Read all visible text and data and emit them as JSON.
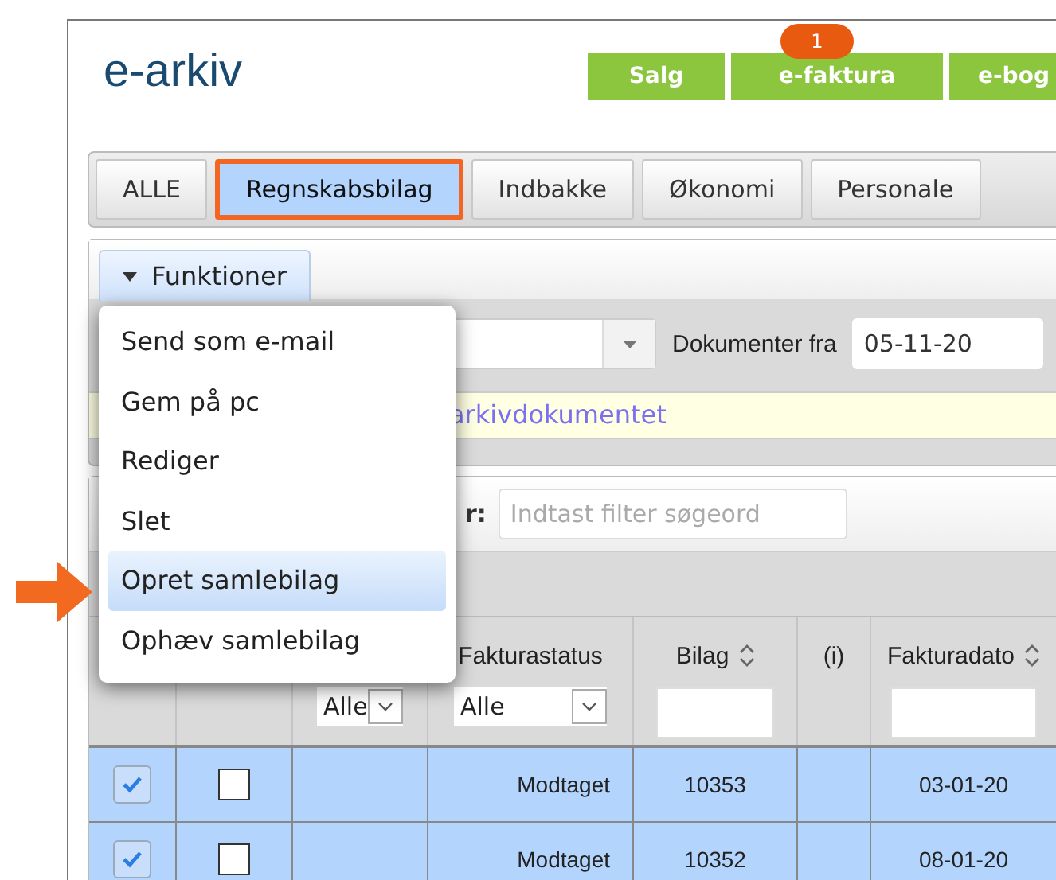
{
  "app_title": "e-arkiv",
  "top_buttons": [
    {
      "label": "Salg"
    },
    {
      "label": "e-faktura",
      "badge": "1"
    },
    {
      "label": "e-bog"
    }
  ],
  "tabs": [
    {
      "label": "ALLE",
      "selected": false
    },
    {
      "label": "Regnskabsbilag",
      "selected": true
    },
    {
      "label": "Indbakke",
      "selected": false
    },
    {
      "label": "Økonomi",
      "selected": false
    },
    {
      "label": "Personale",
      "selected": false
    }
  ],
  "functions_button": "Funktioner",
  "functions_menu": [
    {
      "label": "Send som e-mail",
      "selected": false
    },
    {
      "label": "Gem på pc",
      "selected": false
    },
    {
      "label": "Rediger",
      "selected": false
    },
    {
      "label": "Slet",
      "selected": false
    },
    {
      "label": "Opret samlebilag",
      "selected": true
    },
    {
      "label": "Ophæv samlebilag",
      "selected": false
    }
  ],
  "date_filter": {
    "label": "Dokumenter fra",
    "value": "05-11-20"
  },
  "info_text": "arkivdokumentet",
  "search_filter": {
    "label": "r:",
    "placeholder": "Indtast filter søgeord"
  },
  "table": {
    "columns": [
      {
        "kind": "blank"
      },
      {
        "kind": "blank"
      },
      {
        "kind": "select",
        "value": "Alle"
      },
      {
        "kind": "select",
        "label": "Fakturastatus",
        "value": "Alle"
      },
      {
        "kind": "input",
        "label": "Bilag",
        "sortable": true
      },
      {
        "kind": "plain",
        "label": "(i)"
      },
      {
        "kind": "input",
        "label": "Fakturadato",
        "sortable": true
      }
    ],
    "rows": [
      {
        "selected": true,
        "checked": true,
        "flagged": false,
        "status": "Modtaget",
        "bilag": "10353",
        "date": "03-01-20"
      },
      {
        "selected": true,
        "checked": true,
        "flagged": false,
        "status": "Modtaget",
        "bilag": "10352",
        "date": "08-01-20"
      }
    ]
  }
}
